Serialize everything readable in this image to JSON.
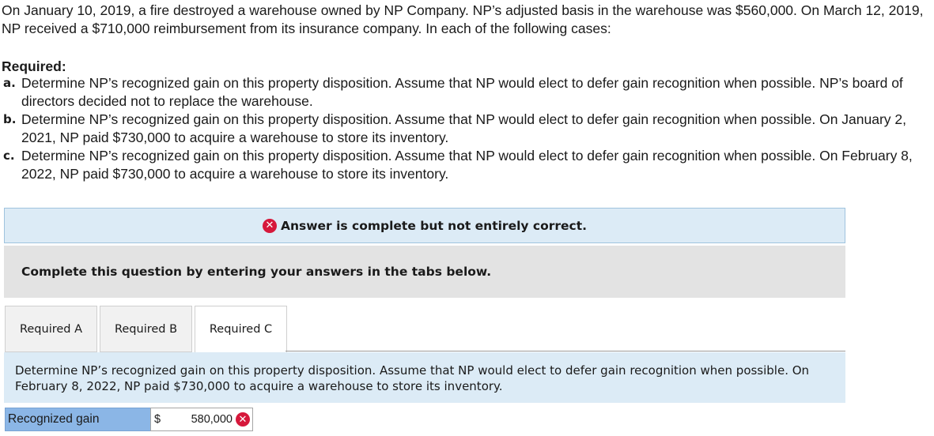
{
  "problem": {
    "intro": "On January 10, 2019, a fire destroyed a warehouse owned by NP Company. NP’s adjusted basis in the warehouse was $560,000. On March 12, 2019, NP received a $710,000 reimbursement from its insurance company. In each of the following cases:",
    "required_title": "Required:",
    "items": [
      {
        "letter": "a.",
        "text": "Determine NP’s recognized gain on this property disposition. Assume that NP would elect to defer gain recognition when possible. NP’s board of directors decided not to replace the warehouse."
      },
      {
        "letter": "b.",
        "text": "Determine NP’s recognized gain on this property disposition. Assume that NP would elect to defer gain recognition when possible. On January 2, 2021, NP paid $730,000 to acquire a warehouse to store its inventory."
      },
      {
        "letter": "c.",
        "text": "Determine NP’s recognized gain on this property disposition. Assume that NP would elect to defer gain recognition when possible. On February 8, 2022, NP paid $730,000 to acquire a warehouse to store its inventory."
      }
    ]
  },
  "banner": {
    "text": "Answer is complete but not entirely correct.",
    "icon": "x-circle-icon",
    "color": "#d6183b"
  },
  "instruction": "Complete this question by entering your answers in the tabs below.",
  "tabs": [
    {
      "label": "Required A"
    },
    {
      "label": "Required B"
    },
    {
      "label": "Required C",
      "active": true
    }
  ],
  "panel": {
    "text": "Determine NP’s recognized gain on this property disposition. Assume that NP would elect to defer gain recognition when possible. On February 8, 2022, NP paid $730,000 to acquire a warehouse to store its inventory."
  },
  "answer": {
    "label": "Recognized gain",
    "currency": "$",
    "value": "580,000",
    "status": "incorrect"
  }
}
